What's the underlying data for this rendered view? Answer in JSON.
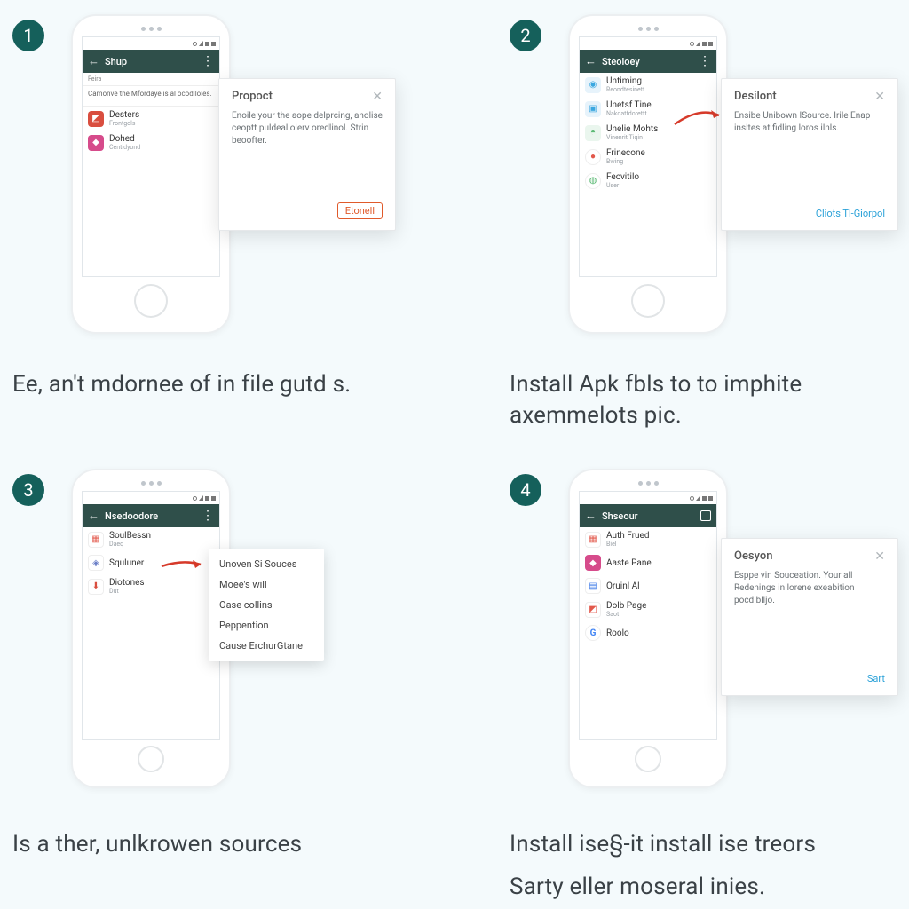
{
  "steps": {
    "s1": {
      "num": "1",
      "appbar_title": "Shup",
      "subbar": "Feira",
      "desc": "Camonve the Mfordaye is al ocodlloles.",
      "rows": [
        {
          "name": "Desters",
          "sub": "Frontgols",
          "color": "#d94e3f"
        },
        {
          "name": "Dohed",
          "sub": "Centidyond",
          "color": "#d64b8b"
        }
      ],
      "popup": {
        "title": "Propoct",
        "body": "Enoile your the aope delprcing, anolise ceoptt puldeal olerv oredlinol. Strin beoofter.",
        "action": "Etonell"
      },
      "caption": "Ee, an't mdornee of in file gutd s."
    },
    "s2": {
      "num": "2",
      "appbar_title": "Steoloey",
      "rows": [
        {
          "name": "Untiming",
          "sub": "Reondtesinett",
          "color": "#3aa7e0",
          "round": false
        },
        {
          "name": "Unetsf Tine",
          "sub": "Nakoatfdorettt",
          "color": "#3aa7e0",
          "round": false
        },
        {
          "name": "Unelie Mohts",
          "sub": "Vinenrit Tiqin",
          "color": "#5bb974",
          "round": false
        },
        {
          "name": "Frinecone",
          "sub": "Bwing",
          "color": "#e2584b",
          "round": true
        },
        {
          "name": "Fecvitilo",
          "sub": "User",
          "color": "#5bb974",
          "round": true
        }
      ],
      "popup": {
        "title": "Desilont",
        "body": "Ensibe Unibown ISource. Irile Enap insltes at fidling loros ilnls.",
        "action": "Cliots Tl-Giorpol"
      },
      "caption": "Install Apk fbls to to imphite axemmelots pic."
    },
    "s3": {
      "num": "3",
      "appbar_title": "Nsedoodore",
      "rows": [
        {
          "name": "SoulBessn",
          "sub": "Daeq",
          "color": "#e2584b"
        },
        {
          "name": "Squluner",
          "sub": "",
          "color": "#6b7fc7"
        },
        {
          "name": "Diotones",
          "sub": "Dut",
          "color": "#d94e3f"
        }
      ],
      "menu": [
        "Unoven Si Souces",
        "Moee's will",
        "Oase collins",
        "Peppention",
        "Cause ErchurGtane"
      ],
      "caption": "Is a ther, unlkrowen sources"
    },
    "s4": {
      "num": "4",
      "appbar_title": "Shseour",
      "rows": [
        {
          "name": "Auth Frued",
          "sub": "Biel",
          "color": "#e2584b"
        },
        {
          "name": "Aaste Pane",
          "sub": "",
          "color": "#d64b8b"
        },
        {
          "name": "Oruinl Al",
          "sub": "",
          "color": "#3b78e7"
        },
        {
          "name": "Dolb Page",
          "sub": "Saot",
          "color": "#e2584b"
        },
        {
          "name": "Roolo",
          "sub": "",
          "color": "#34a853",
          "google": true
        }
      ],
      "popup": {
        "title": "Oesyon",
        "body": "Esppe vin Souceation. Your all Redenings in lorene exeabition pocdiblljo.",
        "action": "Sart"
      },
      "caption": "Install ise§-it install ise treors",
      "caption2": "Sarty eller moseral inies."
    }
  }
}
